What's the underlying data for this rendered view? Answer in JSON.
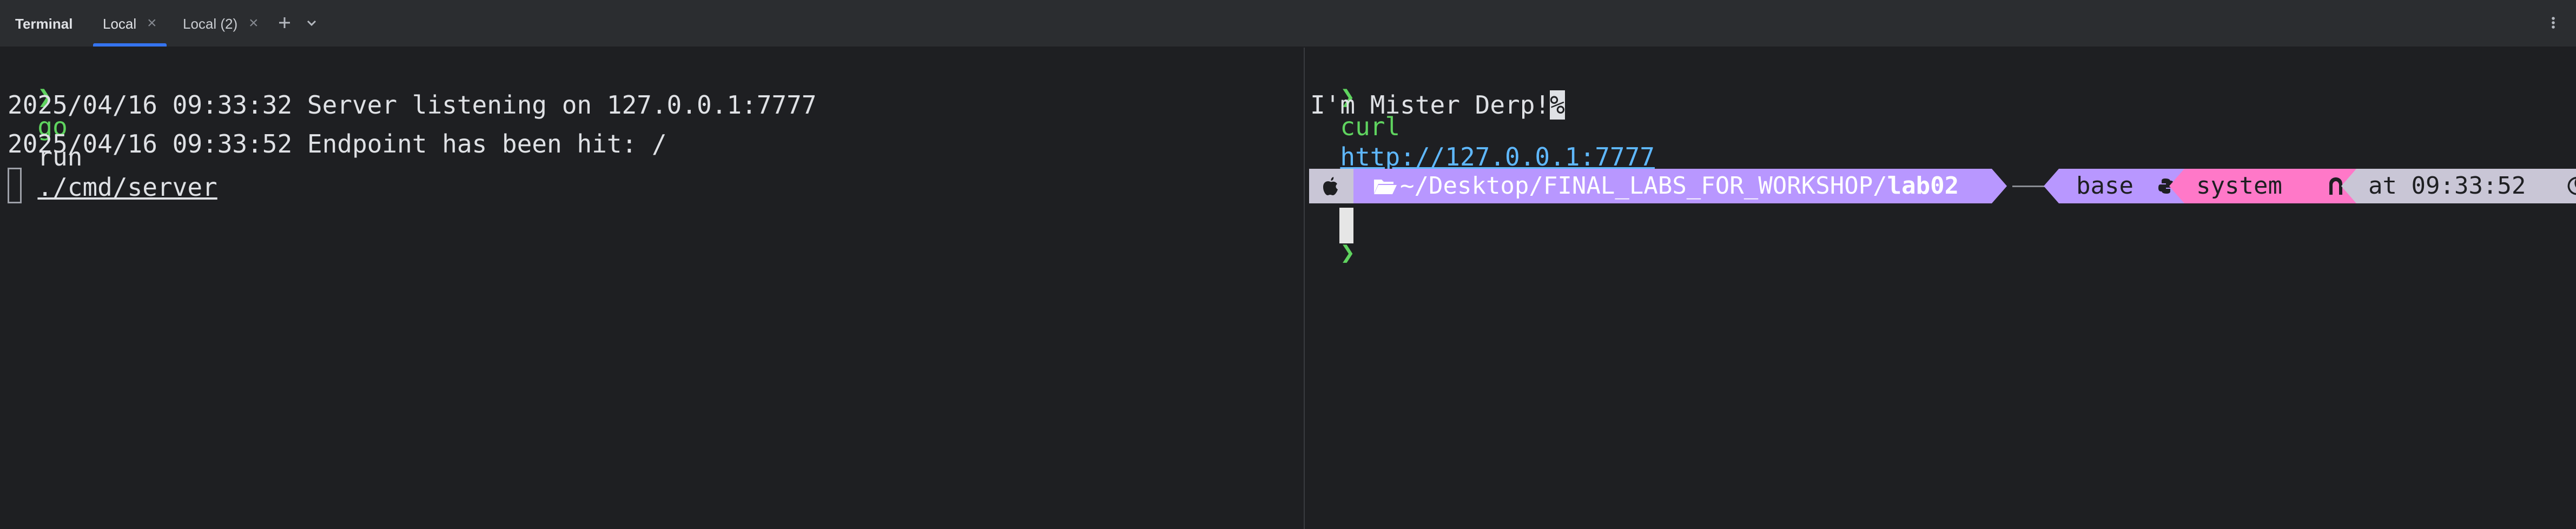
{
  "tabbar": {
    "tool_title": "Terminal",
    "tabs": [
      {
        "label": "Local",
        "active": true
      },
      {
        "label": "Local (2)",
        "active": false
      }
    ],
    "icons": {
      "add": "plus-icon",
      "dropdown": "chevron-down-icon",
      "more": "more-vertical-icon",
      "close": "close-icon"
    },
    "close_glyph": "×"
  },
  "left_pane": {
    "prompt_symbol": "❯",
    "command": {
      "program": "go",
      "args": "run",
      "path": "./cmd/server"
    },
    "output": [
      "2025/04/16 09:33:32 Server listening on 127.0.0.1:7777",
      "2025/04/16 09:33:52 Endpoint has been hit: /"
    ]
  },
  "right_pane": {
    "prompt_symbol": "❯",
    "command": {
      "program": "curl",
      "url": "http://127.0.0.1:7777"
    },
    "response": "I'm Mister Derp!",
    "response_marker": "%",
    "powerline": {
      "os_icon": "apple-icon",
      "folder_icon": "folder-open-icon",
      "path_prefix": "~/Desktop/FINAL_LABS_FOR_WORKSHOP/",
      "path_current": "lab02",
      "env_label": "base",
      "env_icon": "python-icon",
      "version_label": "system",
      "version_icon": "ruby-icon",
      "time_prefix": "at",
      "time": "09:33:52",
      "clock_icon": "clock-icon"
    }
  },
  "colors": {
    "background": "#1e1f22",
    "tabbar": "#2b2d30",
    "prompt_green": "#5fd35f",
    "link_blue": "#5fb8ff",
    "powerline_purple": "#b897ff",
    "powerline_pink": "#ff78c8",
    "powerline_gray": "#c9c6d6",
    "accent_blue": "#3574f0"
  }
}
